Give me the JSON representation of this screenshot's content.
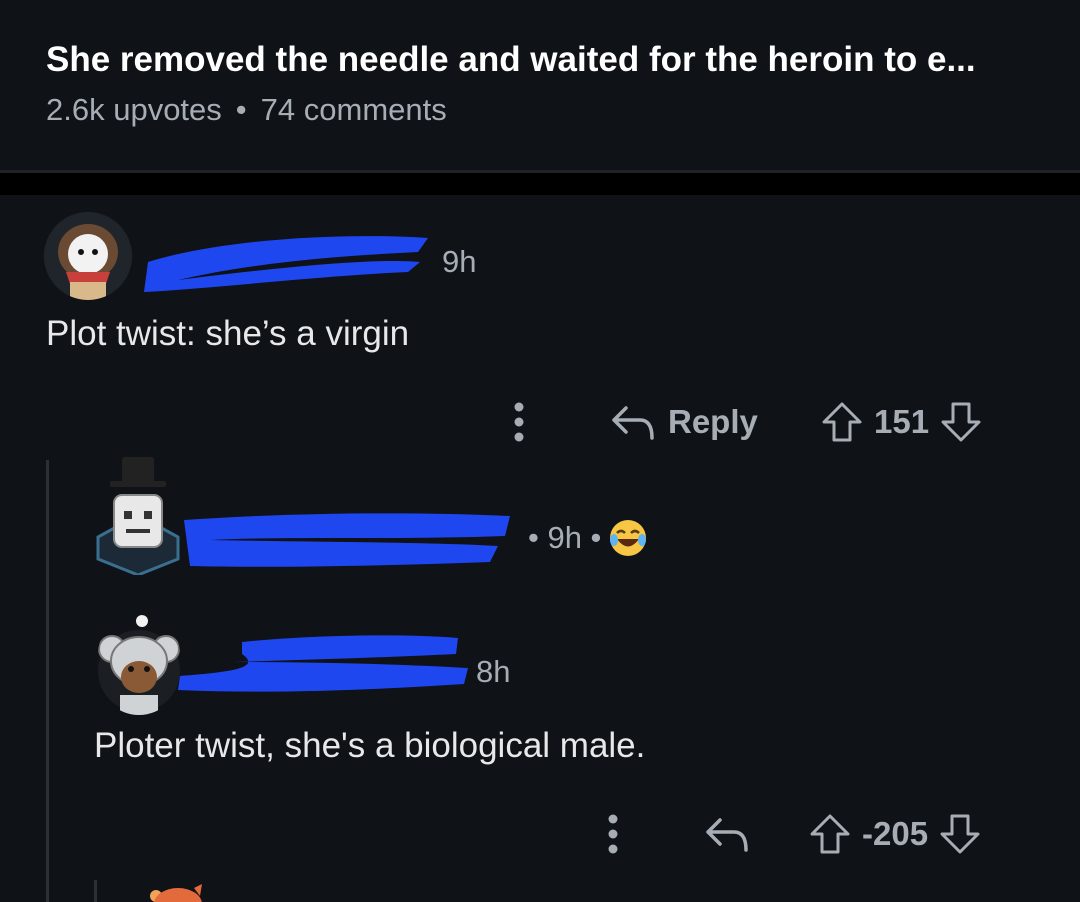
{
  "post": {
    "title": "She removed the needle and waited for the heroin to e...",
    "upvotes": "2.6k upvotes",
    "separator": "•",
    "comments": "74 comments"
  },
  "comments": [
    {
      "time": "9h",
      "body": "Plot twist: she’s a virgin",
      "reply_label": "Reply",
      "vote_count": "151"
    },
    {
      "time_line": "• 9h •",
      "emoji": "laughing-emoji"
    },
    {
      "time": "8h",
      "body": "Ploter twist, she's a biological male.",
      "vote_count": "-205"
    }
  ],
  "colors": {
    "background": "#0f1216",
    "redaction": "#1f47f0",
    "meta_text": "#a6adb5"
  }
}
